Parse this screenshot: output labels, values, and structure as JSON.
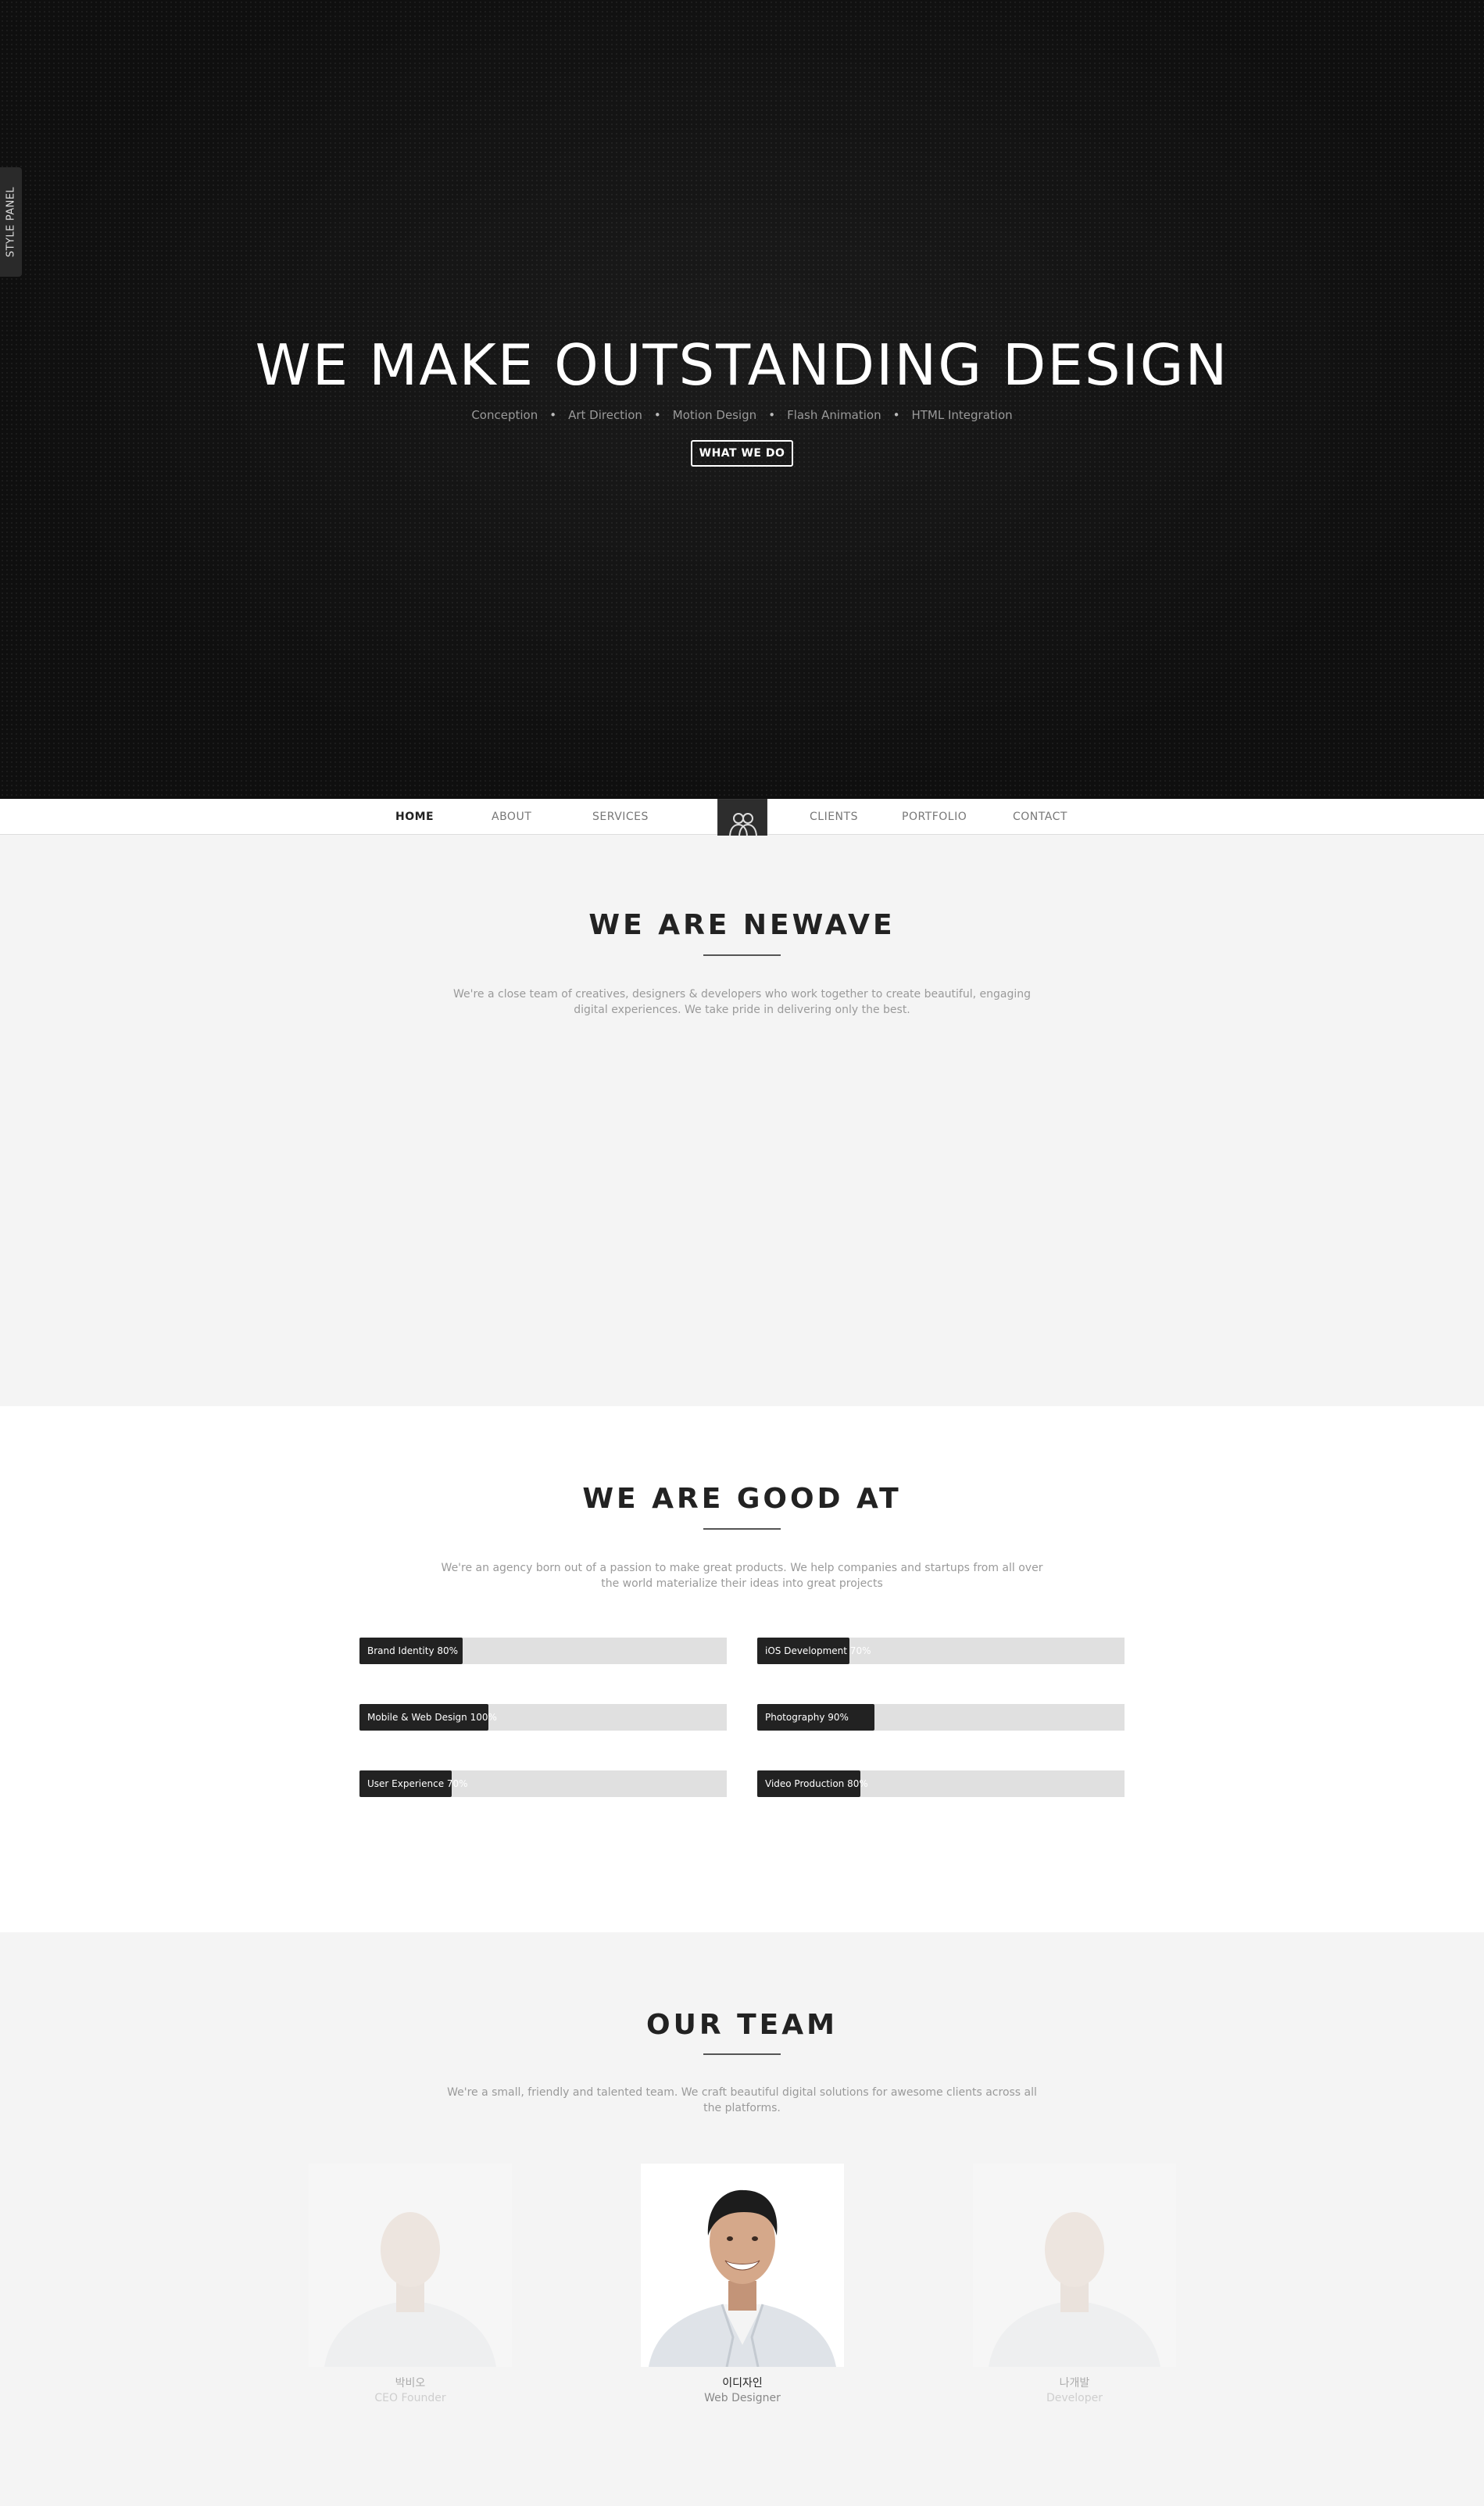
{
  "hero": {
    "title": "WE MAKE OUTSTANDING DESIGN",
    "services": [
      "Conception",
      "Art Direction",
      "Motion Design",
      "Flash Animation",
      "HTML Integration"
    ],
    "dot": "•",
    "button": "WHAT WE DO"
  },
  "style_panel_label": "STYLE PANEL",
  "nav": {
    "items": [
      "HOME",
      "ABOUT",
      "SERVICES",
      "CLIENTS",
      "PORTFOLIO",
      "CONTACT"
    ],
    "active": "HOME"
  },
  "about": {
    "title": "WE ARE NEWAVE",
    "text_line1": "We're a close team of creatives, designers & developers who work together to create beautiful, engaging",
    "text_line2": "digital experiences. We take pride in delivering only the best."
  },
  "skills": {
    "title": "WE ARE GOOD AT",
    "text_line1": "We're an agency born out of a passion to make great products. We help companies and startups from all over",
    "text_line2": "the world materialize their ideas into great projects",
    "items": [
      {
        "label": "Brand Identity 80%",
        "fill": 0.28
      },
      {
        "label": "iOS Development 70%",
        "fill": 0.25
      },
      {
        "label": "Mobile & Web Design 100%",
        "fill": 0.35
      },
      {
        "label": "Photography 90%",
        "fill": 0.32
      },
      {
        "label": "User Experience 70%",
        "fill": 0.25
      },
      {
        "label": "Video Production 80%",
        "fill": 0.28
      }
    ]
  },
  "team": {
    "title": "OUR TEAM",
    "text_line1": "We're a small, friendly and talented team. We craft beautiful digital solutions for awesome clients across all",
    "text_line2": "the platforms.",
    "members": [
      {
        "name": "박비오",
        "role": "CEO Founder"
      },
      {
        "name": "이디자인",
        "role": "Web Designer"
      },
      {
        "name": "나개발",
        "role": "Developer"
      }
    ]
  },
  "colors": {
    "dark": "#141414",
    "accent": "#222222",
    "bar_bg": "#e0e0e0"
  }
}
